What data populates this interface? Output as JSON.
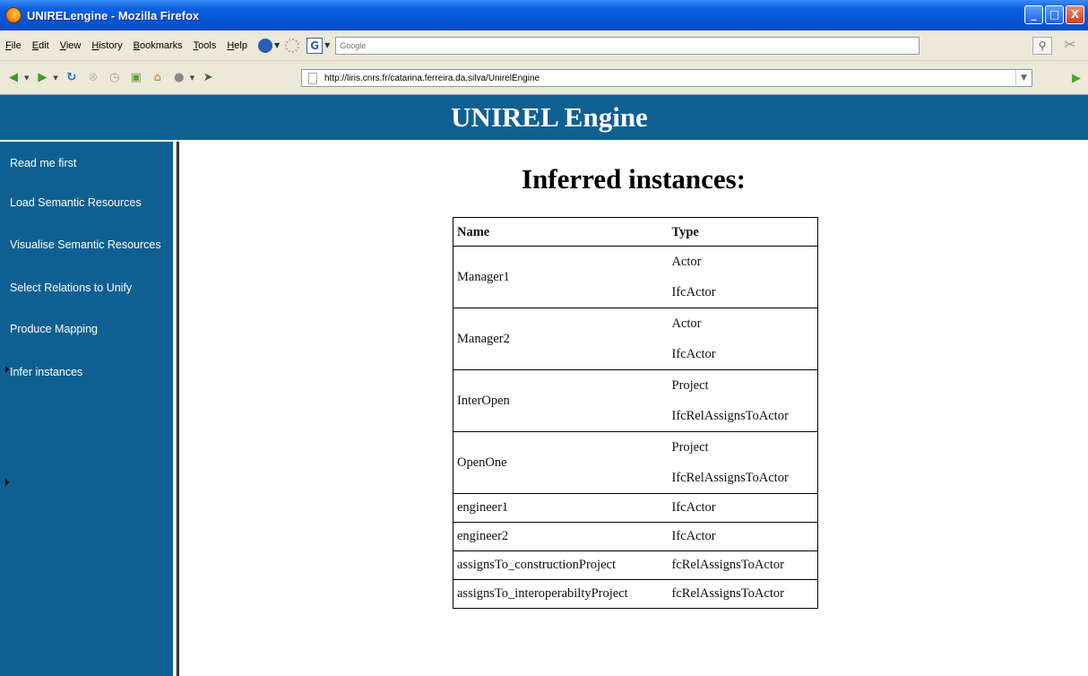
{
  "window": {
    "title": "UNIRELengine - Mozilla Firefox",
    "controls": {
      "minimize": "_",
      "maximize": "□",
      "close": "X"
    }
  },
  "menubar": {
    "items": [
      "File",
      "Edit",
      "View",
      "History",
      "Bookmarks",
      "Tools",
      "Help"
    ],
    "search_button_label": "G",
    "search_placeholder": "Google"
  },
  "navbar": {
    "url": "http://liris.cnrs.fr/catarina.ferreira.da.silva/UnirelEngine"
  },
  "page": {
    "header_title": "UNIREL Engine",
    "sidebar": {
      "items": [
        {
          "label": "Read me first"
        },
        {
          "label": "Load Semantic Resources"
        },
        {
          "label": "Visualise Semantic Resources"
        },
        {
          "label": "Select Relations to Unify"
        },
        {
          "label": "Produce Mapping"
        },
        {
          "label": "Infer instances"
        }
      ]
    },
    "heading": "Inferred instances:",
    "table": {
      "headers": [
        "Name",
        "Type"
      ],
      "rows": [
        {
          "name": "Manager1",
          "types": [
            "Actor",
            "IfcActor"
          ]
        },
        {
          "name": "Manager2",
          "types": [
            "Actor",
            "IfcActor"
          ]
        },
        {
          "name": "InterOpen",
          "types": [
            "Project",
            "IfcRelAssignsToActor"
          ]
        },
        {
          "name": "OpenOne",
          "types": [
            "Project",
            "IfcRelAssignsToActor"
          ]
        },
        {
          "name": "engineer1",
          "types": [
            "IfcActor"
          ]
        },
        {
          "name": "engineer2",
          "types": [
            "IfcActor"
          ]
        },
        {
          "name": "assignsTo_constructionProject",
          "types": [
            "fcRelAssignsToActor"
          ]
        },
        {
          "name": "assignsTo_interoperabiltyProject",
          "types": [
            "fcRelAssignsToActor"
          ]
        }
      ]
    }
  },
  "colors": {
    "header_band": "#0f6092",
    "sidebar": "#0f6092",
    "titlebar": "#0654d6",
    "chrome": "#ece9d8"
  }
}
